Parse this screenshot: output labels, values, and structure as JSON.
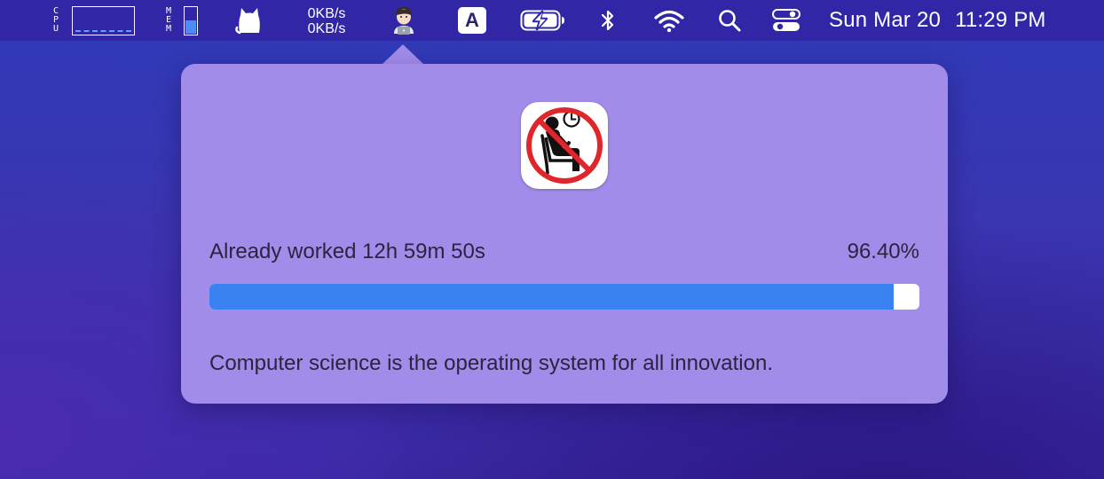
{
  "menubar": {
    "cpu_label": [
      "C",
      "P",
      "U"
    ],
    "mem_label": [
      "M",
      "E",
      "M"
    ],
    "mem_usage": 0.55,
    "net_upload": "0KB/s",
    "net_download": "0KB/s",
    "input_source": "A",
    "date": "Sun Mar 20",
    "time": "11:29 PM",
    "icons": [
      "cpu-graph",
      "memory-bar",
      "cat-icon",
      "network-speed",
      "worker-icon",
      "input-source-icon",
      "battery-charging-icon",
      "bluetooth-icon",
      "wifi-icon",
      "search-icon",
      "control-center-icon"
    ]
  },
  "popover": {
    "status_label": "Already worked 12h 59m 50s",
    "percent_label": "96.40%",
    "progress": 0.964,
    "quote": "Computer science is the operating system for all innovation."
  },
  "colors": {
    "menubar_bg": "#3127a6",
    "popover_bg": "#a28ce9",
    "progress_fill": "#3a82f1",
    "prohibition_red": "#e0262b"
  }
}
